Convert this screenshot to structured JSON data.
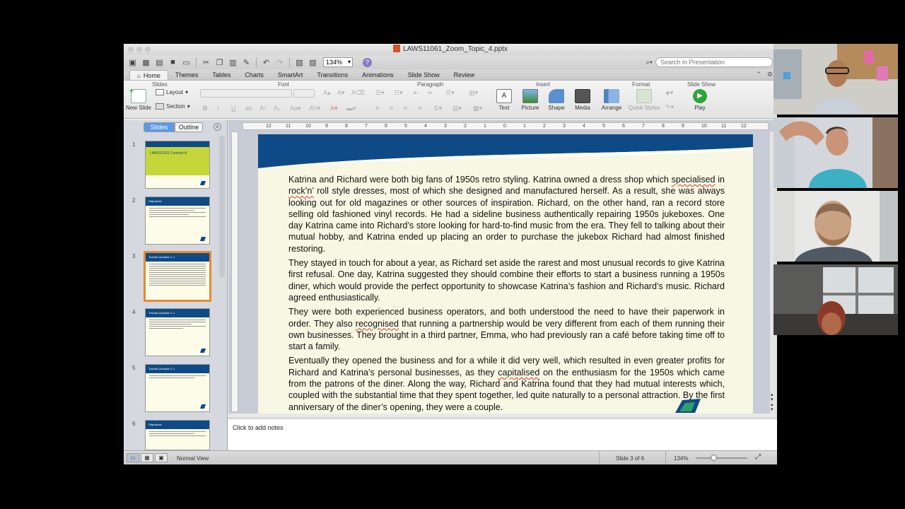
{
  "window": {
    "title": "LAWS11061_Zoom_Topic_4.pptx"
  },
  "toolbar": {
    "zoom_value": "134%",
    "search_placeholder": "Search in Presentation",
    "help_label": "?"
  },
  "ribbon_tabs": [
    {
      "label": "Home",
      "active": true
    },
    {
      "label": "Themes"
    },
    {
      "label": "Tables"
    },
    {
      "label": "Charts"
    },
    {
      "label": "SmartArt"
    },
    {
      "label": "Transitions"
    },
    {
      "label": "Animations"
    },
    {
      "label": "Slide Show"
    },
    {
      "label": "Review"
    }
  ],
  "ribbon": {
    "groups": {
      "slides": "Slides",
      "font": "Font",
      "paragraph": "Paragraph",
      "insert": "Insert",
      "format": "Format",
      "slide_show": "Slide Show"
    },
    "new_slide": "New Slide",
    "layout": "Layout",
    "section": "Section",
    "text": "Text",
    "picture": "Picture",
    "shape": "Shape",
    "media": "Media",
    "arrange": "Arrange",
    "quick_styles": "Quick Styles",
    "play": "Play"
  },
  "panel": {
    "tab_slides": "Slides",
    "tab_outline": "Outline",
    "thumbnails": [
      {
        "num": "1",
        "title": "LAWS11061 Contract A"
      },
      {
        "num": "2",
        "title": "Objectives"
      },
      {
        "num": "3",
        "title": "Tutorial Question 1-1"
      },
      {
        "num": "4",
        "title": "Tutorial Question 1-1"
      },
      {
        "num": "5",
        "title": "Tutorial Question 1-1"
      },
      {
        "num": "6",
        "title": "Objectives"
      }
    ]
  },
  "ruler": {
    "ticks": [
      "12",
      "11",
      "10",
      "9",
      "8",
      "7",
      "6",
      "5",
      "4",
      "3",
      "2",
      "1",
      "0",
      "1",
      "2",
      "3",
      "4",
      "5",
      "6",
      "7",
      "8",
      "9",
      "10",
      "11",
      "12"
    ]
  },
  "slide": {
    "p1_a": "Katrina and Richard were both big fans of 1950s retro styling. Katrina owned a dress shop which ",
    "p1_w1": "specialised",
    "p1_b": " in ",
    "p1_w2": "rock’n’",
    "p1_c": " roll style dresses, most of which she designed and manufactured herself. As a result, she was always looking out for old magazines or other sources of inspiration. Richard, on the other hand, ran a record store selling old fashioned vinyl records. He had a sideline business authentically repairing 1950s jukeboxes. One day Katrina came into Richard’s store looking for hard-to-find music from the era. They fell to talking about their mutual hobby, and Katrina ended up placing an order to purchase the jukebox Richard had almost finished restoring.",
    "p2": "They stayed in touch for about a year, as Richard set aside the rarest and most unusual records to give Katrina first refusal. One day, Katrina suggested they should combine their efforts to start a business running a 1950s diner, which would provide the perfect opportunity to showcase Katrina’s fashion and Richard’s music. Richard agreed enthusiastically.",
    "p3_a": "They were both experienced business operators, and both understood the need to have their paperwork in order. They also ",
    "p3_w": "recognised",
    "p3_b": " that running a partnership would be very different from each of them running their own businesses. They brought in a third partner, Emma, who had previously ran a café before taking time off to start a family.",
    "p4_a": "Eventually they opened the business and for a while it did very well, which resulted in even greater profits for Richard and Katrina’s personal businesses, as they ",
    "p4_w": "capitalised",
    "p4_b": " on the enthusiasm for the 1950s which came from the patrons of the diner. Along the way, Richard and Katrina found that they had mutual interests which, coupled with the substantial time that they spent together, led quite naturally to a personal attraction. By the first anniversary of the diner’s opening, they were a couple."
  },
  "notes": {
    "placeholder": "Click to add notes"
  },
  "status": {
    "view": "Normal View",
    "slide_counter": "Slide 3 of 6",
    "zoom": "134%"
  },
  "colors": {
    "slide_band": "#0e4a86",
    "slide_bg": "#f8f7e3",
    "selection": "#e68a2e",
    "accent_green": "#c5d63a"
  }
}
